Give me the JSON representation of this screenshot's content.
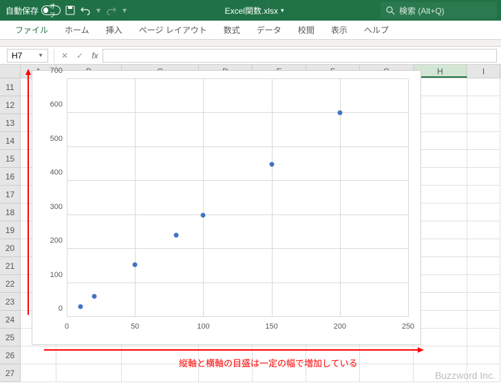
{
  "titlebar": {
    "autosave_label": "自動保存",
    "autosave_state": "オフ",
    "filename": "Excel関数.xlsx",
    "search_placeholder": "検索 (Alt+Q)"
  },
  "ribbon": {
    "tabs": [
      "ファイル",
      "ホーム",
      "挿入",
      "ページ レイアウト",
      "数式",
      "データ",
      "校閲",
      "表示",
      "ヘルプ"
    ]
  },
  "formula_bar": {
    "namebox": "H7",
    "formula": ""
  },
  "columns": [
    "A",
    "B",
    "C",
    "D",
    "E",
    "F",
    "G",
    "H",
    "I"
  ],
  "active_column": "H",
  "rows": [
    11,
    12,
    13,
    14,
    15,
    16,
    17,
    18,
    19,
    20,
    21,
    22,
    23,
    24,
    25,
    26,
    27
  ],
  "chart_data": {
    "type": "scatter",
    "x": [
      10,
      20,
      50,
      80,
      100,
      150,
      200
    ],
    "y": [
      30,
      60,
      153,
      240,
      300,
      450,
      600
    ],
    "xlim": [
      0,
      250
    ],
    "ylim": [
      0,
      700
    ],
    "xticks": [
      0,
      50,
      100,
      150,
      200,
      250
    ],
    "yticks": [
      0,
      100,
      200,
      300,
      400,
      500,
      600,
      700
    ],
    "title": "",
    "xlabel": "",
    "ylabel": ""
  },
  "annotation": "縦軸と横軸の目盛は一定の幅で増加している",
  "watermark": "Buzzword Inc."
}
